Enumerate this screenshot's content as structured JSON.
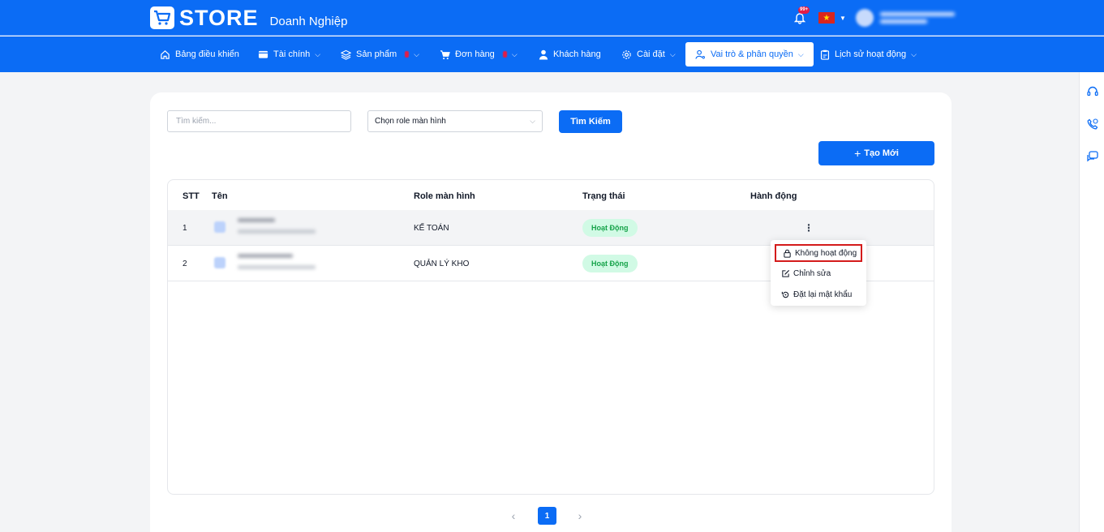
{
  "header": {
    "logo_text": "STORE",
    "logo_subtitle": "Doanh Nghiệp",
    "notification_count": "99+"
  },
  "nav": [
    {
      "label": "Bảng điều khiển",
      "icon": "home-icon"
    },
    {
      "label": "Tài chính",
      "icon": "wallet-icon"
    },
    {
      "label": "Sản phẩm",
      "icon": "layers-icon"
    },
    {
      "label": "Đơn hàng",
      "icon": "cart-icon"
    },
    {
      "label": "Khách hàng",
      "icon": "user-icon"
    },
    {
      "label": "Cài đặt",
      "icon": "gear-icon"
    },
    {
      "label": "Vai trò & phân quyền",
      "icon": "user-key-icon",
      "active": true
    },
    {
      "label": "Lịch sử hoạt động",
      "icon": "clipboard-icon"
    }
  ],
  "filters": {
    "search_placeholder": "Tìm kiếm...",
    "role_select_value": "Chọn role màn hình",
    "search_button": "Tìm Kiếm",
    "create_button": "Tạo Mới"
  },
  "table": {
    "headers": [
      "STT",
      "Tên",
      "Role màn hình",
      "Trạng thái",
      "Hành động"
    ],
    "rows": [
      {
        "stt": "1",
        "role": "KẾ TOÁN",
        "status": "Hoạt Động"
      },
      {
        "stt": "2",
        "role": "QUẢN LÝ KHO",
        "status": "Hoạt Động"
      }
    ]
  },
  "action_menu": {
    "items": [
      {
        "label": "Không hoạt động",
        "icon": "lock-icon"
      },
      {
        "label": "Chỉnh sửa",
        "icon": "edit-icon"
      },
      {
        "label": "Đặt lại mật khẩu",
        "icon": "reset-icon"
      }
    ]
  },
  "pagination": {
    "current_page": "1",
    "prev": "‹",
    "next": "›"
  },
  "colors": {
    "primary": "#0b6cf5",
    "status_bg": "#d1fae5",
    "status_text": "#16a34a",
    "highlight_border": "#d41b1b"
  }
}
